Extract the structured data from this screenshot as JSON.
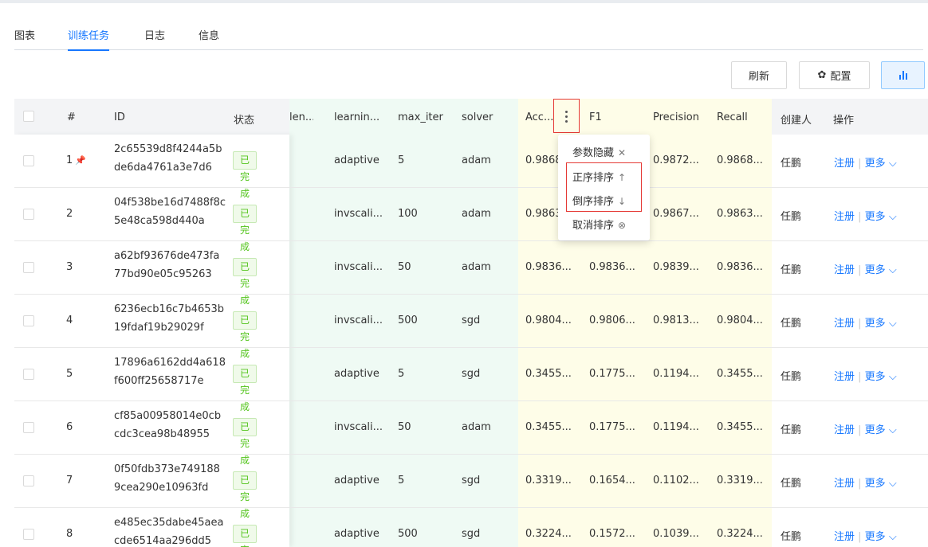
{
  "tabs": [
    "图表",
    "训练任务",
    "日志",
    "信息"
  ],
  "toolbar": {
    "refresh_label": "刷新",
    "config_label": "配置"
  },
  "table": {
    "headers": {
      "index": "#",
      "id": "ID",
      "status": "状态",
      "hidden": "len...",
      "learning": "learnin...",
      "max_iter": "max_iter",
      "solver": "solver",
      "accuracy": "Acc...",
      "f1": "F1",
      "precision": "Precision",
      "recall": "Recall",
      "creator": "创建人",
      "actions": "操作"
    },
    "rows": [
      {
        "n": "1",
        "id1": "2c65539d8f4244a5b",
        "id2": "de6da4761a3e7d6",
        "status": "已完成",
        "learning": "adaptive",
        "max_iter": "5",
        "solver": "adam",
        "acc": "0.9868",
        "f1": "",
        "precision": "0.9872...",
        "recall": "0.9868...",
        "creator": "任鹏",
        "register": "注册",
        "more": "更多"
      },
      {
        "n": "2",
        "id1": "04f538be16d7488f8c",
        "id2": "5e48ca598d440a",
        "status": "已完成",
        "learning": "invscali...",
        "max_iter": "100",
        "solver": "adam",
        "acc": "0.9863",
        "f1": "",
        "precision": "0.9867...",
        "recall": "0.9863...",
        "creator": "任鹏",
        "register": "注册",
        "more": "更多"
      },
      {
        "n": "3",
        "id1": "a62bf93676de473fa",
        "id2": "77bd90e05c95263",
        "status": "已完成",
        "learning": "invscali...",
        "max_iter": "50",
        "solver": "adam",
        "acc": "0.9836...",
        "f1": "0.9836...",
        "precision": "0.9839...",
        "recall": "0.9836...",
        "creator": "任鹏",
        "register": "注册",
        "more": "更多"
      },
      {
        "n": "4",
        "id1": "6236ecb16c7b4653b",
        "id2": "19fdaf19b29029f",
        "status": "已完成",
        "learning": "invscali...",
        "max_iter": "500",
        "solver": "sgd",
        "acc": "0.9804...",
        "f1": "0.9806...",
        "precision": "0.9813...",
        "recall": "0.9804...",
        "creator": "任鹏",
        "register": "注册",
        "more": "更多"
      },
      {
        "n": "5",
        "id1": "17896a6162dd4a618",
        "id2": "f600ff25658717e",
        "status": "已完成",
        "learning": "adaptive",
        "max_iter": "5",
        "solver": "sgd",
        "acc": "0.3455...",
        "f1": "0.1775...",
        "precision": "0.1194...",
        "recall": "0.3455...",
        "creator": "任鹏",
        "register": "注册",
        "more": "更多"
      },
      {
        "n": "6",
        "id1": "cf85a00958014e0cb",
        "id2": "cdc3cea98b48955",
        "status": "已完成",
        "learning": "invscali...",
        "max_iter": "50",
        "solver": "adam",
        "acc": "0.3455...",
        "f1": "0.1775...",
        "precision": "0.1194...",
        "recall": "0.3455...",
        "creator": "任鹏",
        "register": "注册",
        "more": "更多"
      },
      {
        "n": "7",
        "id1": "0f50fdb373e749188",
        "id2": "9cea290e10963fd",
        "status": "已完成",
        "learning": "adaptive",
        "max_iter": "5",
        "solver": "sgd",
        "acc": "0.3319...",
        "f1": "0.1654...",
        "precision": "0.1102...",
        "recall": "0.3319...",
        "creator": "任鹏",
        "register": "注册",
        "more": "更多"
      },
      {
        "n": "8",
        "id1": "e485ec35dabe45aea",
        "id2": "cde6514aa296dd5",
        "status": "已完成",
        "learning": "adaptive",
        "max_iter": "500",
        "solver": "sgd",
        "acc": "0.3224...",
        "f1": "0.1572...",
        "precision": "0.1039...",
        "recall": "0.3224...",
        "creator": "任鹏",
        "register": "注册",
        "more": "更多"
      }
    ]
  },
  "column_menu": {
    "hide_label": "参数隐藏",
    "asc_label": "正序排序",
    "desc_label": "倒序排序",
    "cancel_label": "取消排序",
    "hide_glyph": "✕",
    "asc_glyph": "↑",
    "desc_glyph": "↓",
    "cancel_glyph": "⊗"
  },
  "colors": {
    "accent": "#1677ff",
    "success": "#52c41a",
    "highlight_border": "#e53935"
  }
}
